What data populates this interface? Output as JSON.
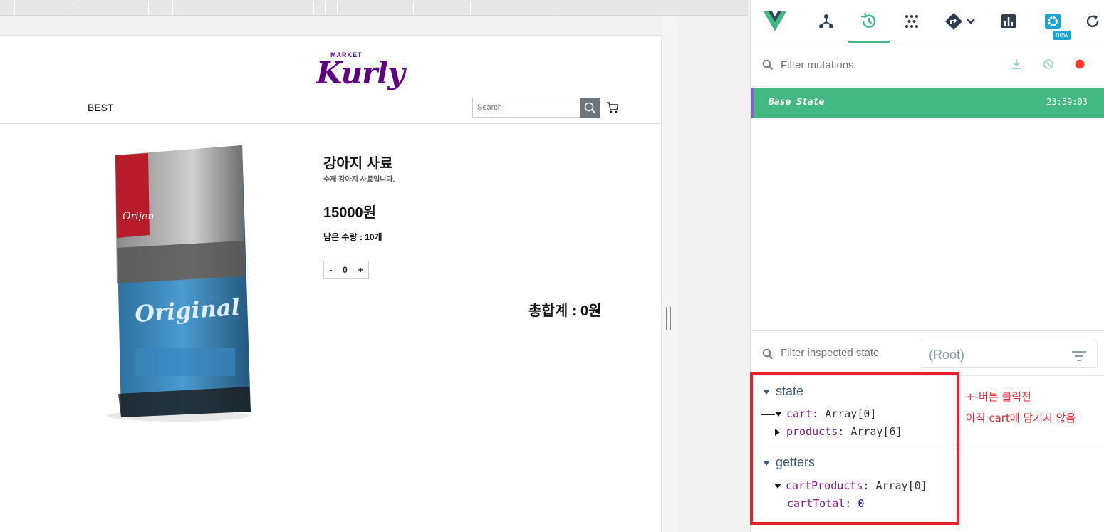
{
  "page": {
    "logo": {
      "small": "MARKET",
      "big": "Kurly"
    },
    "nav": {
      "best": "BEST"
    },
    "search": {
      "placeholder": "Search"
    },
    "product": {
      "title": "강아지 사료",
      "description": "수제 강아지 사료입니다.",
      "price": "15000원",
      "stock_label": "남은 수량 : ",
      "stock_value": "10개",
      "qty_minus": "-",
      "qty_value": "0",
      "qty_plus": "+",
      "total": "총합계 : 0원"
    }
  },
  "devtools": {
    "toolbar": {
      "new_badge": "new"
    },
    "mutations": {
      "filter_placeholder": "Filter mutations"
    },
    "base_state": {
      "label": "Base State",
      "time": "23:59:03"
    },
    "inspector": {
      "filter_placeholder": "Filter inspected state",
      "root_select": "(Root)"
    },
    "tree": {
      "state_label": "state",
      "cart_key": "cart",
      "cart_val": "Array[0]",
      "products_key": "products",
      "products_val": "Array[6]",
      "getters_label": "getters",
      "cartProducts_key": "cartProducts",
      "cartProducts_val": "Array[0]",
      "cartTotal_key": "cartTotal",
      "cartTotal_val": "0"
    },
    "colors": {
      "vue_green": "#42b983",
      "highlight_red": "#e8202a"
    }
  },
  "annotation": {
    "line1": "+-버튼 클릭전",
    "line2": "아직 cart에 담기지 않음"
  }
}
